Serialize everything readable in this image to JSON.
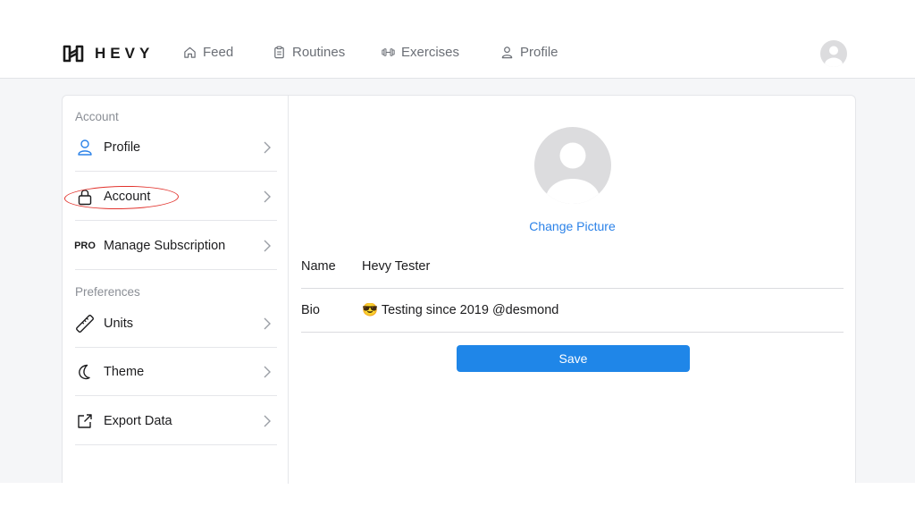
{
  "app": {
    "logo_text": "HEVY"
  },
  "nav": {
    "items": [
      {
        "label": "Feed",
        "icon": "home-icon"
      },
      {
        "label": "Routines",
        "icon": "clipboard-icon"
      },
      {
        "label": "Exercises",
        "icon": "dumbbell-icon"
      },
      {
        "label": "Profile",
        "icon": "user-icon"
      }
    ],
    "avatar_icon": "avatar-placeholder-icon"
  },
  "sidebar": {
    "section_account": "Account",
    "section_preferences": "Preferences",
    "items": [
      {
        "label": "Profile",
        "icon": "user-icon",
        "active": true
      },
      {
        "label": "Account",
        "icon": "lock-icon",
        "annotated": true
      },
      {
        "label": "Manage Subscription",
        "icon": "pro-badge",
        "badge": "PRO"
      },
      {
        "label": "Units",
        "icon": "ruler-icon"
      },
      {
        "label": "Theme",
        "icon": "moon-icon"
      },
      {
        "label": "Export Data",
        "icon": "export-icon"
      }
    ]
  },
  "profile_form": {
    "change_picture": "Change Picture",
    "name_label": "Name",
    "name_value": "Hevy Tester",
    "bio_label": "Bio",
    "bio_value": "😎 Testing since 2019 @desmond",
    "save_label": "Save"
  },
  "colors": {
    "accent": "#1f86e8",
    "link": "#2b82e8",
    "active_icon": "#2b82e8",
    "annotation": "#e2332d",
    "content_bg": "#f5f6f8"
  }
}
